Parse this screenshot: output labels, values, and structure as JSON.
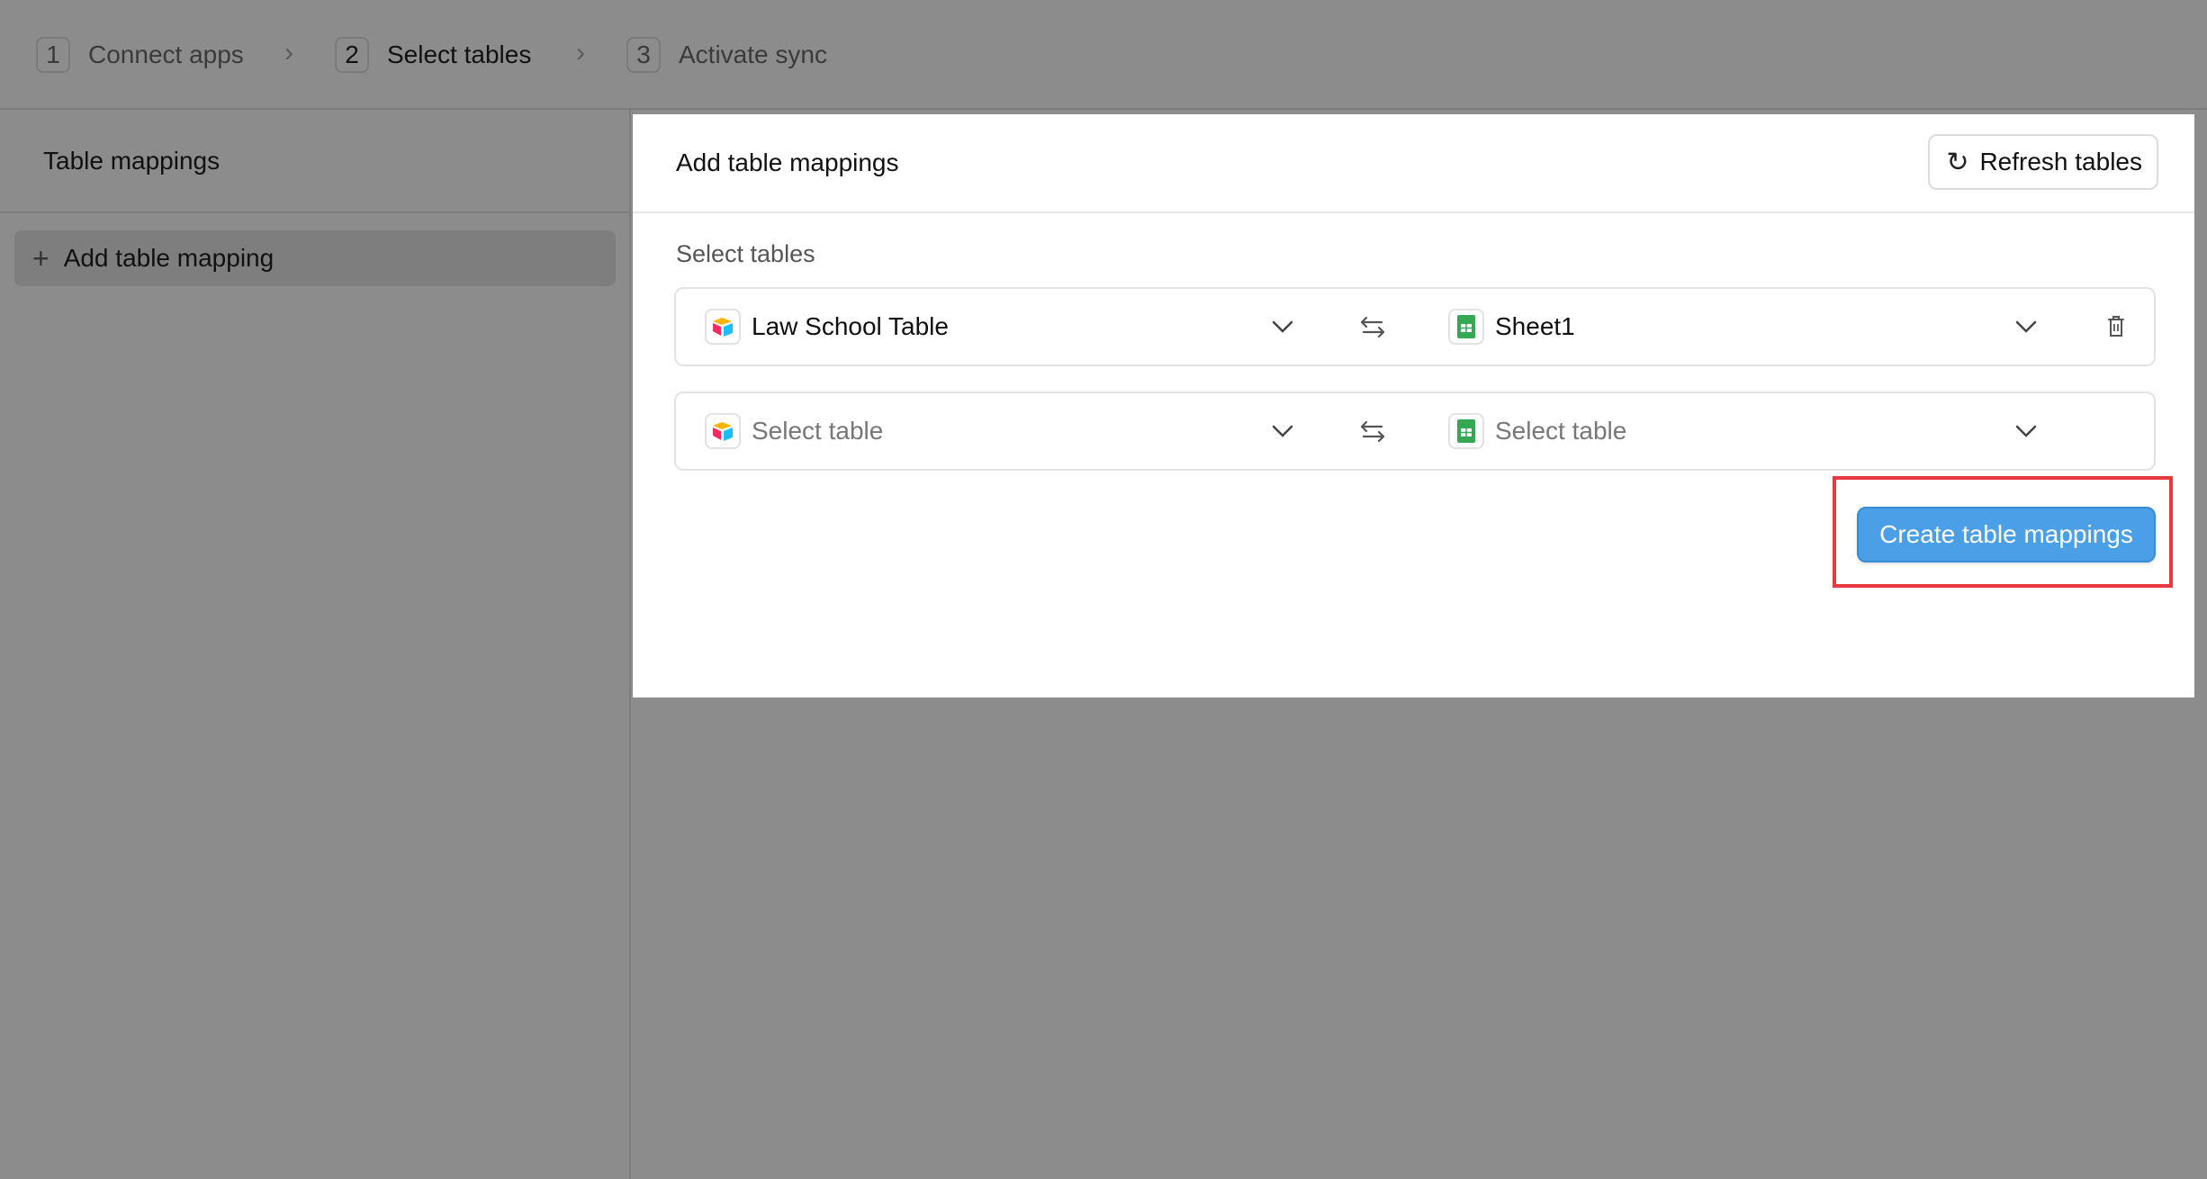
{
  "stepper": {
    "steps": [
      {
        "number": "1",
        "label": "Connect apps"
      },
      {
        "number": "2",
        "label": "Select tables"
      },
      {
        "number": "3",
        "label": "Activate sync"
      }
    ],
    "active_step": "2"
  },
  "sidebar": {
    "title": "Table mappings",
    "add_button_label": "Add table mapping"
  },
  "panel": {
    "title": "Add table mappings",
    "refresh_label": "Refresh tables",
    "section_label": "Select tables",
    "rows": [
      {
        "source_value": "Law School Table",
        "source_app": "airtable-icon",
        "target_value": "Sheet1",
        "target_app": "google-sheets-icon"
      },
      {
        "source_placeholder": "Select table",
        "source_app": "airtable-icon",
        "target_placeholder": "Select table",
        "target_app": "google-sheets-icon"
      }
    ],
    "create_label": "Create table mappings"
  },
  "colors": {
    "overlay_gray": "#8c8c8c",
    "primary_button": "#4a9fe6",
    "highlight_box": "#e8393f",
    "sheets_green": "#34a853"
  }
}
